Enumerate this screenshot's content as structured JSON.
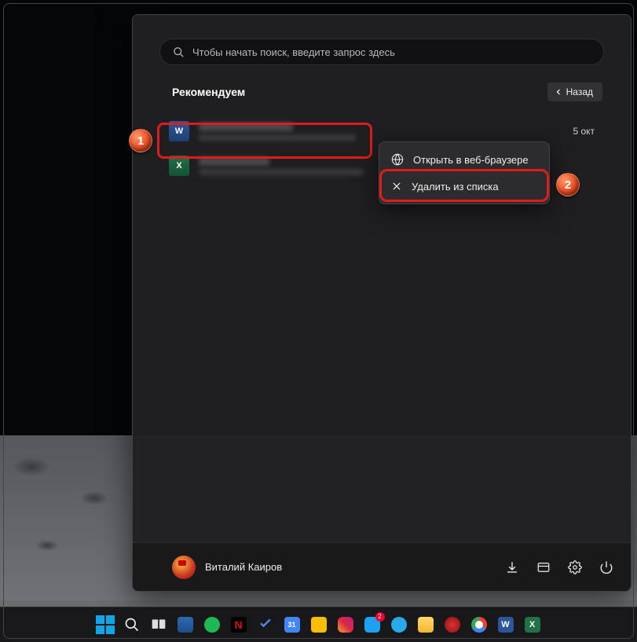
{
  "search": {
    "placeholder": "Чтобы начать поиск, введите запрос здесь"
  },
  "heading": "Рекомендуем",
  "back_label": "Назад",
  "files": [
    {
      "icon": "word",
      "letter": "W",
      "date": "5 окт"
    },
    {
      "icon": "excel",
      "letter": "X",
      "date": ""
    }
  ],
  "context_menu": {
    "open_browser": "Открыть в веб-браузере",
    "remove": "Удалить из списка"
  },
  "user_name": "Виталий Каиров",
  "badges": {
    "one": "1",
    "two": "2"
  },
  "taskbar_notif": "2"
}
